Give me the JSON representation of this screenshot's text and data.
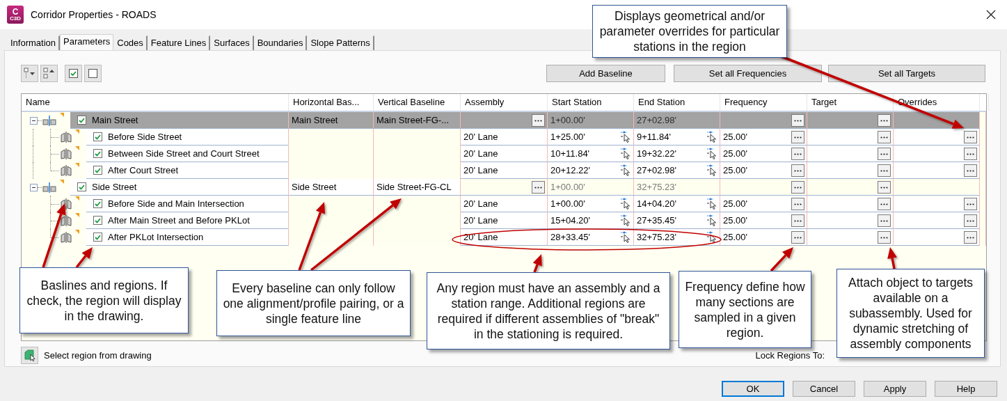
{
  "window": {
    "title": "Corridor Properties - ROADS",
    "app_icon": {
      "letter": "C",
      "caption": "C3D"
    }
  },
  "tabs": [
    {
      "label": "Information",
      "selected": false
    },
    {
      "label": "Parameters",
      "selected": true
    },
    {
      "label": "Codes",
      "selected": false
    },
    {
      "label": "Feature Lines",
      "selected": false
    },
    {
      "label": "Surfaces",
      "selected": false
    },
    {
      "label": "Boundaries",
      "selected": false
    },
    {
      "label": "Slope Patterns",
      "selected": false
    }
  ],
  "toolbar": {
    "buttons": [
      "Add Baseline",
      "Set all Frequencies",
      "Set all Targets"
    ]
  },
  "table": {
    "columns": [
      "Name",
      "Horizontal Bas...",
      "Vertical Baseline",
      "Assembly",
      "Start Station",
      "End Station",
      "Frequency",
      "Target",
      "Overrides"
    ],
    "baselines": [
      {
        "name": "Main Street",
        "checked": true,
        "expanded": true,
        "selected": true,
        "horizontal_baseline": "Main Street",
        "vertical_baseline": "Main Street-FG-...",
        "start_station": "1+00.00'",
        "end_station": "27+02.98'",
        "children": [
          {
            "name": "Before Side Street",
            "checked": true,
            "assembly": "20' Lane",
            "start_station": "1+25.00'",
            "end_station": "9+11.84'",
            "frequency": "25.00'"
          },
          {
            "name": "Between Side Street and Court Street",
            "checked": true,
            "assembly": "20' Lane",
            "start_station": "10+11.84'",
            "end_station": "19+32.22'",
            "frequency": "25.00'"
          },
          {
            "name": "After Court Street",
            "checked": true,
            "assembly": "20' Lane",
            "start_station": "20+12.22'",
            "end_station": "27+02.98'",
            "frequency": "25.00'"
          }
        ]
      },
      {
        "name": "Side Street",
        "checked": true,
        "expanded": true,
        "selected": false,
        "horizontal_baseline": "Side Street",
        "vertical_baseline": "Side Street-FG-CL",
        "start_station": "1+00.00'",
        "end_station": "32+75.23'",
        "children": [
          {
            "name": "Before Side and Main Intersection",
            "checked": true,
            "assembly": "20' Lane",
            "start_station": "1+00.00'",
            "end_station": "14+04.20'",
            "frequency": "25.00'"
          },
          {
            "name": "After Main Street and Before PKLot",
            "checked": true,
            "assembly": "20' Lane",
            "start_station": "15+04.20'",
            "end_station": "27+35.45'",
            "frequency": "25.00'"
          },
          {
            "name": "After PKLot Intersection",
            "checked": true,
            "assembly": "20' Lane",
            "start_station": "28+33.45'",
            "end_station": "32+75.23'",
            "frequency": "25.00'"
          }
        ]
      }
    ]
  },
  "footer": {
    "select_region": "Select region from drawing",
    "lock_regions": "Lock Regions To:"
  },
  "dialog_buttons": [
    {
      "label": "OK",
      "default": true
    },
    {
      "label": "Cancel",
      "default": false
    },
    {
      "label": "Apply",
      "default": false
    },
    {
      "label": "Help",
      "default": false
    }
  ],
  "callouts": [
    {
      "text": "Displays geometrical and/or parameter overrides for particular stations in the region"
    },
    {
      "text": "Baslines and regions. If check, the region will display in the drawing."
    },
    {
      "text": "Every baseline can only follow one alignment/profile pairing, or a single feature line"
    },
    {
      "text": "Any region must have an assembly and a station range. Additional regions are required if different assemblies of \"break\" in the stationing is required."
    },
    {
      "text": "Frequency define how many sections are sampled in a given region."
    },
    {
      "text": "Attach object to targets available on a subassembly. Used for dynamic stretching of assembly components"
    }
  ]
}
